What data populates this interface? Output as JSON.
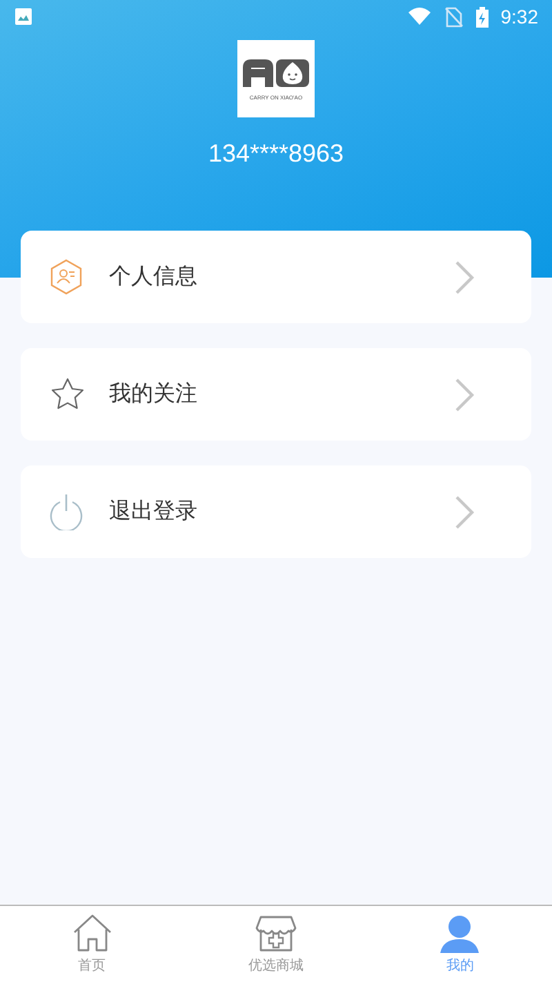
{
  "status_bar": {
    "time": "9:32"
  },
  "profile": {
    "logo_caption": "CARRY ON XIAO'AO",
    "phone": "134****8963"
  },
  "menu": [
    {
      "kind": "profile",
      "label": "个人信息"
    },
    {
      "kind": "star",
      "label": "我的关注"
    },
    {
      "kind": "power",
      "label": "退出登录"
    }
  ],
  "tabs": [
    {
      "kind": "home",
      "label": "首页",
      "selected": false
    },
    {
      "kind": "shop",
      "label": "优选商城",
      "selected": false
    },
    {
      "kind": "user",
      "label": "我的",
      "selected": true
    }
  ]
}
